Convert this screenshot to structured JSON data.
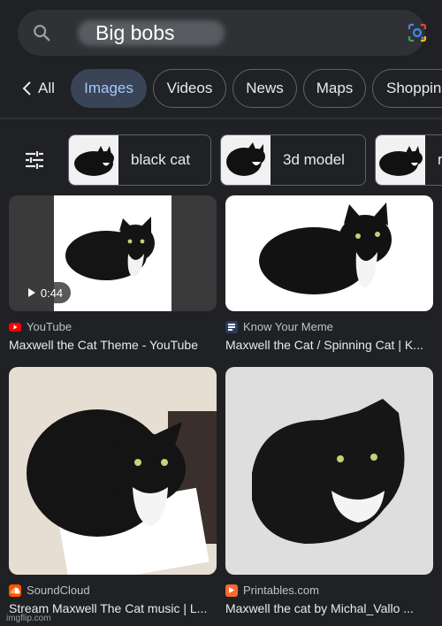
{
  "search": {
    "query": "Big bobs"
  },
  "icons": {
    "search": "search-icon",
    "lens": "google-lens-icon",
    "back": "chevron-left-icon",
    "tune": "tune-icon",
    "play": "play-icon"
  },
  "tabs": [
    {
      "label": "All",
      "active": false
    },
    {
      "label": "Images",
      "active": true
    },
    {
      "label": "Videos",
      "active": false
    },
    {
      "label": "News",
      "active": false
    },
    {
      "label": "Maps",
      "active": false
    },
    {
      "label": "Shoppin",
      "active": false
    }
  ],
  "chips": [
    {
      "label": "black cat"
    },
    {
      "label": "3d model"
    },
    {
      "label": "r"
    }
  ],
  "results": [
    {
      "source": "YouTube",
      "title": "Maxwell the Cat Theme - YouTube",
      "duration": "0:44"
    },
    {
      "source": "Know Your Meme",
      "title": "Maxwell the Cat / Spinning Cat | K..."
    },
    {
      "source": "SoundCloud",
      "title": "Stream Maxwell The Cat music | L..."
    },
    {
      "source": "Printables.com",
      "title": "Maxwell the cat by Michal_Vallo ..."
    }
  ],
  "watermark": "imgflip.com",
  "colors": {
    "background": "#202124",
    "active_tab_bg": "#394457",
    "active_tab_text": "#a8c7fa",
    "youtube": "#ff0000",
    "soundcloud": "#ff5500",
    "printables": "#fa6831"
  }
}
